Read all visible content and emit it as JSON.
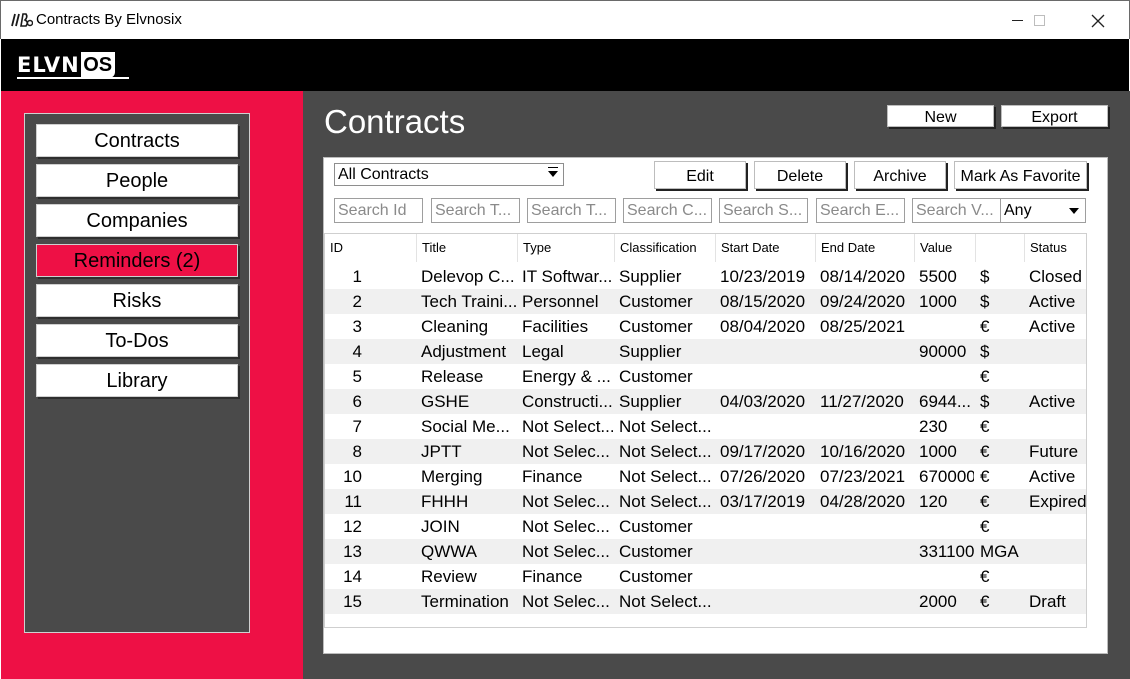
{
  "window": {
    "title": "Contracts By Elvnosix",
    "app_icon": "app-logo-icon",
    "app_icon_text": "ΙΙΒB"
  },
  "brand": {
    "logo_text": "ELVN",
    "logo_box": "OS"
  },
  "sidebar": {
    "items": [
      {
        "label": "Contracts",
        "active": false
      },
      {
        "label": "People",
        "active": false
      },
      {
        "label": "Companies",
        "active": false
      },
      {
        "label": "Reminders (2)",
        "active": true
      },
      {
        "label": "Risks",
        "active": false
      },
      {
        "label": "To-Dos",
        "active": false
      },
      {
        "label": "Library",
        "active": false
      }
    ]
  },
  "main": {
    "title": "Contracts",
    "new_label": "New",
    "export_label": "Export",
    "filter_select": "All Contracts",
    "edit_label": "Edit",
    "delete_label": "Delete",
    "archive_label": "Archive",
    "favorite_label": "Mark As Favorite",
    "searches": [
      "Search Id",
      "Search T...",
      "Search T...",
      "Search C...",
      "Search S...",
      "Search E...",
      "Search V..."
    ],
    "status_select": "Any"
  },
  "table": {
    "columns": [
      "ID",
      "Title",
      "Type",
      "Classification",
      "Start Date",
      "End Date",
      "Value",
      "",
      "Status"
    ],
    "rows": [
      [
        "1",
        "Delevop C...",
        "IT Softwar...",
        "Supplier",
        "10/23/2019",
        "08/14/2020",
        "5500",
        "$",
        "Closed"
      ],
      [
        "2",
        "Tech Traini...",
        "Personnel",
        "Customer",
        "08/15/2020",
        "09/24/2020",
        "1000",
        "$",
        "Active"
      ],
      [
        "3",
        "Cleaning",
        "Facilities",
        "Customer",
        "08/04/2020",
        "08/25/2021",
        "",
        "€",
        "Active"
      ],
      [
        "4",
        "Adjustment",
        "Legal",
        "Supplier",
        "",
        "",
        "90000",
        "$",
        ""
      ],
      [
        "5",
        "Release",
        "Energy & ...",
        "Customer",
        "",
        "",
        "",
        "€",
        ""
      ],
      [
        "6",
        "GSHE",
        "Constructi...",
        "Supplier",
        "04/03/2020",
        "11/27/2020",
        "6944...",
        "$",
        "Active"
      ],
      [
        "7",
        "Social Me...",
        "Not Select...",
        "Not Select...",
        "",
        "",
        "230",
        "€",
        ""
      ],
      [
        "8",
        "JPTT",
        "Not Selec...",
        "Not Select...",
        "09/17/2020",
        "10/16/2020",
        "1000",
        "€",
        "Future"
      ],
      [
        "10",
        "Merging",
        "Finance",
        "Not Select...",
        "07/26/2020",
        "07/23/2021",
        "670000",
        "€",
        "Active"
      ],
      [
        "11",
        "FHHH",
        "Not Selec...",
        "Not Select...",
        "03/17/2019",
        "04/28/2020",
        "120",
        "€",
        "Expired"
      ],
      [
        "12",
        "JOIN",
        "Not Selec...",
        "Customer",
        "",
        "",
        "",
        "€",
        ""
      ],
      [
        "13",
        "QWWA",
        "Not Selec...",
        "Customer",
        "",
        "",
        "331100",
        "MGA",
        ""
      ],
      [
        "14",
        "Review",
        "Finance",
        "Customer",
        "",
        "",
        "",
        "€",
        ""
      ],
      [
        "15",
        "Termination",
        "Not Selec...",
        "Not Select...",
        "",
        "",
        "2000",
        "€",
        "Draft"
      ]
    ]
  },
  "colors": {
    "accent": "#ee1045",
    "panel": "#4a4a4a",
    "brandbar": "#000000"
  }
}
